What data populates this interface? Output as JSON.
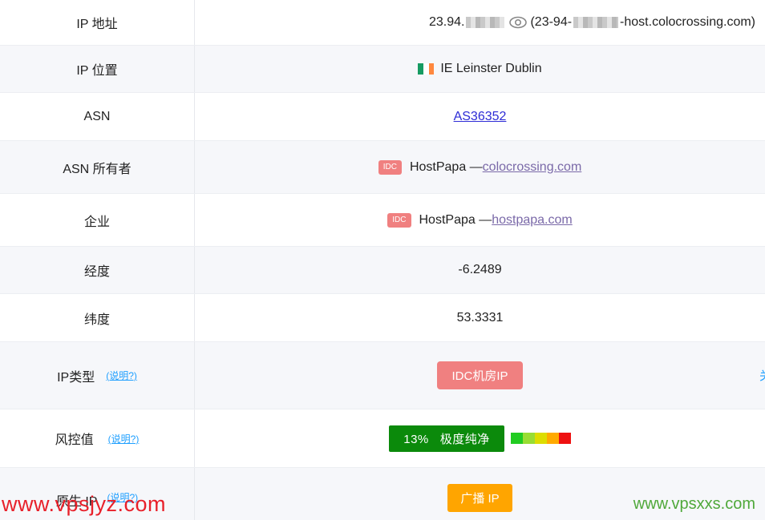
{
  "rows": {
    "ip_address": {
      "label": "IP 地址",
      "value_prefix": "23.94.",
      "value_middle": "(23-94-",
      "value_suffix": "-host.colocrossing.com)"
    },
    "ip_location": {
      "label": "IP 位置",
      "value": "IE Leinster Dublin"
    },
    "asn": {
      "label": "ASN",
      "value": "AS36352"
    },
    "asn_owner": {
      "label": "ASN 所有者",
      "badge": "IDC",
      "name": "HostPapa —",
      "link": "colocrossing.com"
    },
    "enterprise": {
      "label": "企业",
      "badge": "IDC",
      "name": "HostPapa —",
      "link": "hostpapa.com"
    },
    "longitude": {
      "label": "经度",
      "value": "-6.2489"
    },
    "latitude": {
      "label": "纬度",
      "value": "53.3331"
    },
    "ip_type": {
      "label": "IP类型",
      "help": "(说明?)",
      "value": "IDC机房IP",
      "edge_text": "关"
    },
    "risk": {
      "label": "风控值",
      "help": "(说明?)",
      "value": "13%   极度纯净",
      "bar_colors": [
        "#22cc22",
        "#99dd33",
        "#dddd00",
        "#ffaa00",
        "#ee1111"
      ]
    },
    "native_ip": {
      "label": "原生 IP",
      "help": "(说明?)",
      "value": "广播 IP"
    }
  },
  "colors": {
    "idc": "#f08080",
    "risk_green": "#0b8a0b",
    "native_orange": "#ffa500",
    "help_blue": "#1e9fff",
    "flag_ie": [
      "#169b62",
      "#ffffff",
      "#ff883e"
    ]
  },
  "watermarks": {
    "left": "www.vpsjyz.com",
    "right": "www.vpsxxs.com"
  }
}
